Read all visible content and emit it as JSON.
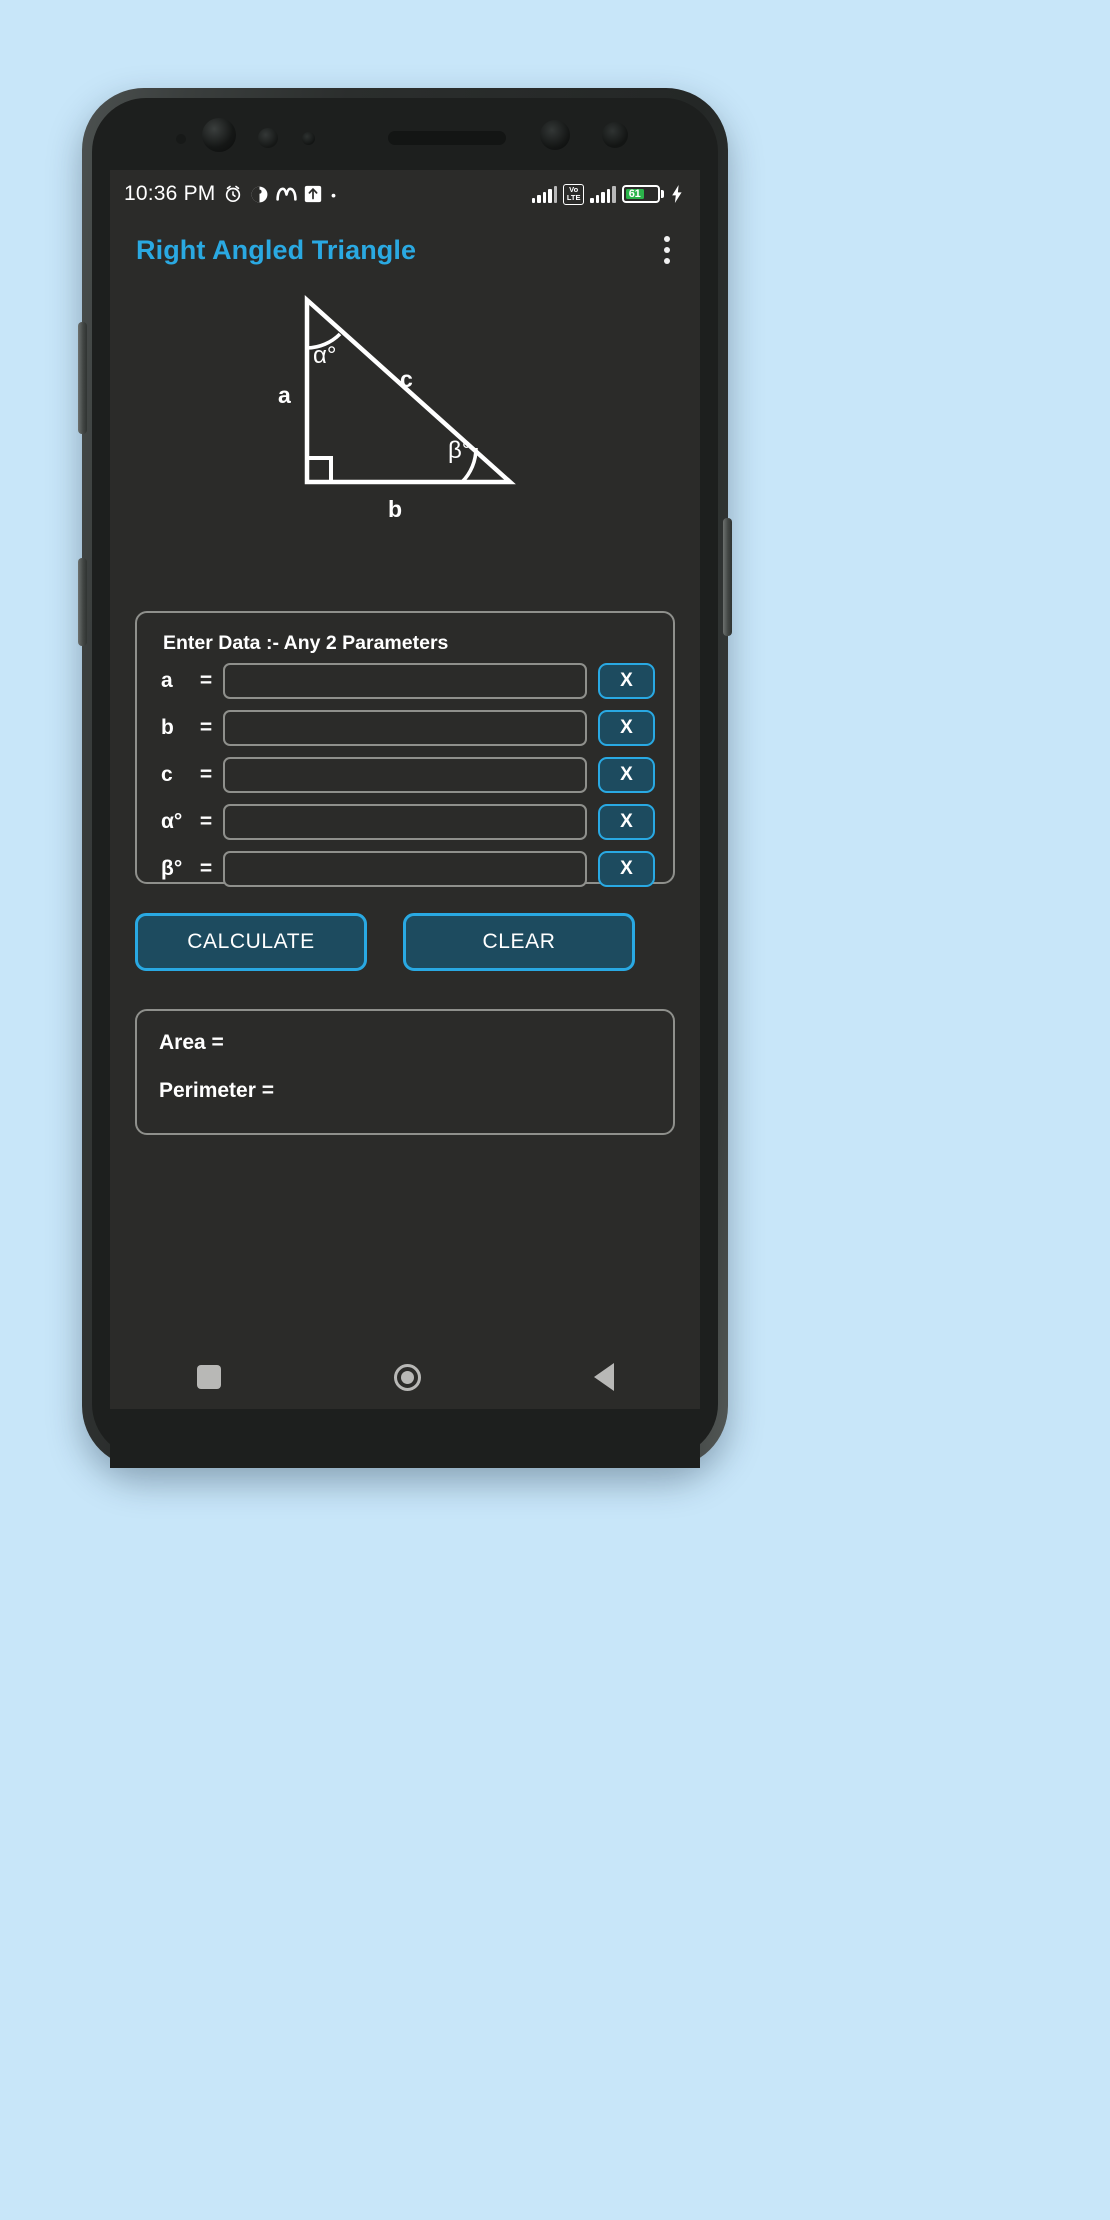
{
  "background_color": "#c8e6f9",
  "accent_color": "#29a9e3",
  "screen_bg": "#2b2b29",
  "status_bar": {
    "clock": "10:36 PM",
    "left_icons": [
      "alarm-clock-icon",
      "contrast-circle-icon",
      "m-letter-icon",
      "upload-box-icon",
      "dot-icon"
    ],
    "volte_line1": "Vo",
    "volte_line2": "LTE",
    "battery_percent": "61",
    "battery_fill_color": "#2bb34a",
    "right_icons": [
      "signal-bars-sim1-icon",
      "volte-badge",
      "signal-bars-sim2-icon",
      "battery-icon",
      "charging-bolt-icon"
    ]
  },
  "app_bar": {
    "title": "Right Angled Triangle",
    "overflow_icon": "overflow-menu-icon"
  },
  "figure": {
    "side_a_label": "a",
    "side_b_label": "b",
    "side_c_label": "c",
    "alpha_label": "α°",
    "beta_label": "β°",
    "stroke_color": "#ffffff"
  },
  "input_card": {
    "title": "Enter Data :-  Any 2 Parameters",
    "clear_button_label": "X",
    "fields": [
      {
        "label": "a",
        "eq": "=",
        "value": "",
        "placeholder": ""
      },
      {
        "label": "b",
        "eq": "=",
        "value": "",
        "placeholder": ""
      },
      {
        "label": "c",
        "eq": "=",
        "value": "",
        "placeholder": ""
      },
      {
        "label": "α°",
        "eq": "=",
        "value": "",
        "placeholder": ""
      },
      {
        "label": "β°",
        "eq": "=",
        "value": "",
        "placeholder": ""
      }
    ]
  },
  "actions": {
    "calculate_label": "CALCULATE",
    "clear_label": "CLEAR"
  },
  "results": {
    "area_label": "Area =",
    "perimeter_label": "Perimeter ="
  },
  "nav_bar": {
    "recents": "recents-square-icon",
    "home": "home-circle-icon",
    "back": "back-triangle-icon"
  }
}
